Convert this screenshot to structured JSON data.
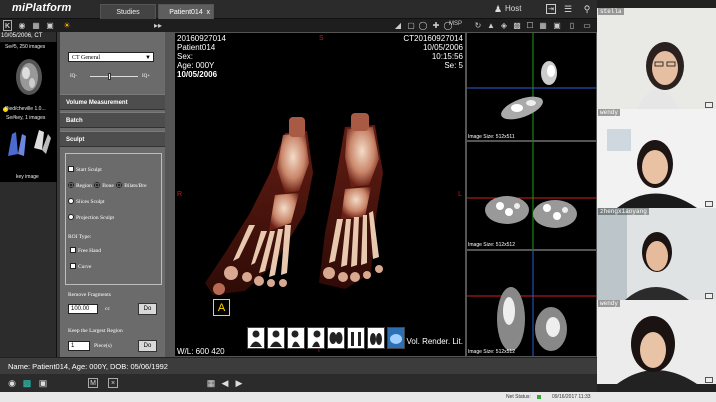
{
  "app": {
    "logo_prefix": "mi",
    "logo_suffix": "Platform"
  },
  "tabs": [
    {
      "label": "Studies"
    },
    {
      "label": "Patient014",
      "close": "x"
    }
  ],
  "header": {
    "host_label": "Host"
  },
  "toolbar": {
    "k_label": "K",
    "mpr_label": "MSP"
  },
  "series": {
    "date": "10/05/2006, CT",
    "items": [
      {
        "count": "Se#5, 250 images",
        "name": "Pied/cheville 1.0..."
      },
      {
        "count": "Se#key, 1 images",
        "name": "key image"
      }
    ]
  },
  "tool_panel": {
    "preset": "CT General",
    "slider_left": "IQ-",
    "slider_right": "IQ+",
    "sections": {
      "volume": "Volume Measurement",
      "batch": "Batch",
      "sculpt": "Sculpt"
    },
    "start_sculpt": "Start Sculpt",
    "mode_region": "Region",
    "mode_bone": "Bone",
    "mode_bilats": "Bilats/Bre",
    "slices_sculpt": "Slices Sculpt",
    "projection_sculpt": "Projection Sculpt",
    "roi_type": "ROI Type:",
    "free_hand": "Free Hand",
    "curve": "Curve",
    "remove_fragments": "Remove Fragments",
    "fragment_value": "100.00",
    "fragment_unit": "cc",
    "do": "Do",
    "keep_largest": "Keep the Largest Region",
    "pieces_value": "1",
    "pieces_unit": "Piece(s)"
  },
  "viewport": {
    "tl": [
      "20160927014",
      "Patient014",
      "Sex:",
      "Age: 000Y"
    ],
    "tl_date": "10/05/2006",
    "tr": [
      "CT20160927014",
      "10/05/2006",
      "10:15:56",
      "Se: 5"
    ],
    "orient_top": "S",
    "orient_left": "R",
    "orient_right": "L",
    "orient_bottom": "I",
    "anterior": "A",
    "wl": "W/L: 600 420",
    "render_mode": "Vol. Render. Lit."
  },
  "subviews": [
    {
      "size": "Image Size: 512x511"
    },
    {
      "size": "Image Size: 512x512"
    },
    {
      "size": "Image Size: 512x512"
    }
  ],
  "status": {
    "patient_line": "Name: Patient014, Age: 000Y, DOB: 05/06/1992"
  },
  "net": {
    "label": "Net Status:",
    "datetime": "09/16/2017 11:33"
  },
  "participants": [
    "stella",
    "wendy",
    "zhengxiaoyang",
    "wendy"
  ],
  "colors": {
    "accent_yellow": "#ffd800",
    "orient_red": "#dd1111",
    "bone": "#e8c9b0",
    "tissue": "#8a2b1e"
  }
}
